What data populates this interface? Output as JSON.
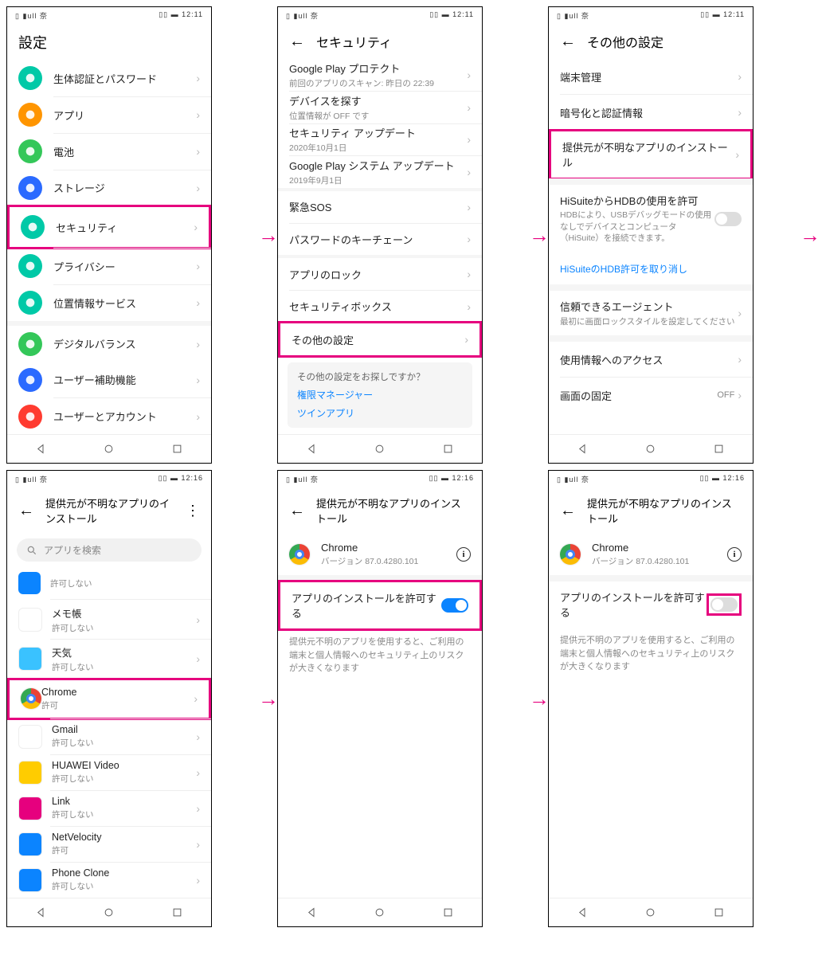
{
  "status": {
    "left": "▯ ▮ull 奈",
    "right": "▯▯ ▬ 12:11",
    "right2": "▯▯ ▬ 12:16"
  },
  "s1": {
    "title": "設定",
    "items": [
      {
        "label": "生体認証とパスワード",
        "color": "#00c9a7",
        "icon": "shield"
      },
      {
        "label": "アプリ",
        "color": "#ff9500",
        "icon": "apps"
      },
      {
        "label": "電池",
        "color": "#34c759",
        "icon": "battery"
      },
      {
        "label": "ストレージ",
        "color": "#2b6aff",
        "icon": "storage"
      },
      {
        "label": "セキュリティ",
        "color": "#00c9a7",
        "icon": "security",
        "hl": true
      },
      {
        "label": "プライバシー",
        "color": "#00c9a7",
        "icon": "privacy"
      },
      {
        "label": "位置情報サービス",
        "color": "#00c9a7",
        "icon": "location"
      },
      {
        "label": "デジタルバランス",
        "color": "#34c759",
        "icon": "digital",
        "sep": true
      },
      {
        "label": "ユーザー補助機能",
        "color": "#2b6aff",
        "icon": "a11y"
      },
      {
        "label": "ユーザーとアカウント",
        "color": "#ff3b30",
        "icon": "users"
      }
    ]
  },
  "s2": {
    "title": "セキュリティ",
    "g1": [
      {
        "label": "Google Play プロテクト",
        "sub": "前回のアプリのスキャン: 昨日の 22:39"
      },
      {
        "label": "デバイスを探す",
        "sub": "位置情報が OFF です"
      },
      {
        "label": "セキュリティ アップデート",
        "sub": "2020年10月1日"
      },
      {
        "label": "Google Play システム アップデート",
        "sub": "2019年9月1日"
      }
    ],
    "g2": [
      {
        "label": "緊急SOS"
      },
      {
        "label": "パスワードのキーチェーン"
      }
    ],
    "g3": [
      {
        "label": "アプリのロック"
      },
      {
        "label": "セキュリティボックス"
      },
      {
        "label": "その他の設定",
        "hl": true
      }
    ],
    "card": {
      "q": "その他の設定をお探しですか？",
      "links": [
        "権限マネージャー",
        "ツインアプリ"
      ]
    }
  },
  "s3": {
    "title": "その他の設定",
    "g1": [
      {
        "label": "端末管理"
      },
      {
        "label": "暗号化と認証情報"
      },
      {
        "label": "提供元が不明なアプリのインストール",
        "hl": true
      }
    ],
    "hisuite": {
      "label": "HiSuiteからHDBの使用を許可",
      "sub": "HDBにより、USBデバッグモードの使用なしでデバイスとコンピュータ（HiSuite）を接続できます。"
    },
    "hlink": "HiSuiteのHDB許可を取り消し",
    "trust": {
      "label": "信頼できるエージェント",
      "sub": "最初に画面ロックスタイルを設定してください"
    },
    "g3": [
      {
        "label": "使用情報へのアクセス"
      },
      {
        "label": "画面の固定",
        "val": "OFF"
      }
    ]
  },
  "s4": {
    "title": "提供元が不明なアプリのインストール",
    "search": "アプリを検索",
    "first": {
      "sub": "許可しない"
    },
    "apps": [
      {
        "label": "メモ帳",
        "sub": "許可しない",
        "bg": "#fff"
      },
      {
        "label": "天気",
        "sub": "許可しない",
        "bg": "#3ac2ff"
      },
      {
        "label": "Chrome",
        "sub": "許可",
        "hl": true,
        "chrome": true
      },
      {
        "label": "Gmail",
        "sub": "許可しない",
        "bg": "#fff"
      },
      {
        "label": "HUAWEI Video",
        "sub": "許可しない",
        "bg": "#ffcc00"
      },
      {
        "label": "Link",
        "sub": "許可しない",
        "bg": "#e6007e"
      },
      {
        "label": "NetVelocity",
        "sub": "許可",
        "bg": "#0b84ff"
      },
      {
        "label": "Phone Clone",
        "sub": "許可しない",
        "bg": "#0b84ff"
      }
    ]
  },
  "s5": {
    "title": "提供元が不明なアプリのインストール",
    "app": "Chrome",
    "ver": "バージョン 87.0.4280.101",
    "allow": "アプリのインストールを許可する",
    "warn": "提供元不明のアプリを使用すると、ご利用の端末と個人情報へのセキュリティ上のリスクが大きくなります"
  }
}
